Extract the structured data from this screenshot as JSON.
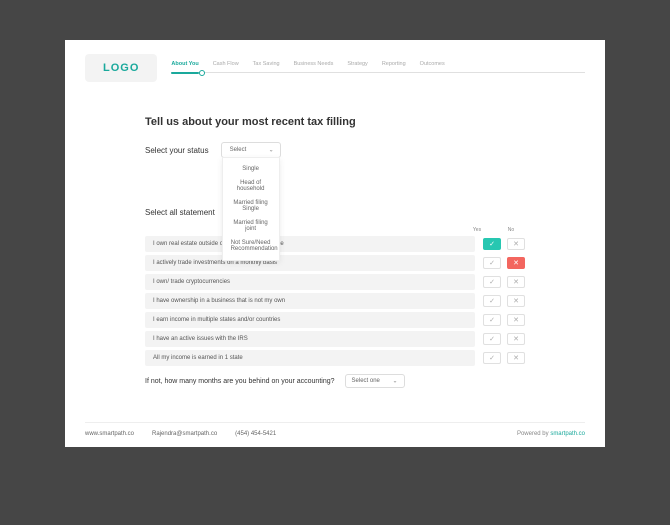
{
  "logo": "LOGO",
  "tabs": [
    {
      "label": "About You",
      "active": true
    },
    {
      "label": "Cash Flow",
      "active": false
    },
    {
      "label": "Tax Saving",
      "active": false
    },
    {
      "label": "Business Needs",
      "active": false
    },
    {
      "label": "Strategy",
      "active": false
    },
    {
      "label": "Reporting",
      "active": false
    },
    {
      "label": "Outcomes",
      "active": false
    }
  ],
  "title": "Tell us about your most recent tax filling",
  "status": {
    "label": "Select your status",
    "placeholder": "Select",
    "options": [
      "Single",
      "Head of household",
      "Married filing Single",
      "Married filing joint",
      "Not Sure/Need Recommendation"
    ]
  },
  "statements": {
    "label": "Select all statement",
    "yes": "Yes",
    "no": "No",
    "items": [
      {
        "text": "I own real estate outside of my primary residence",
        "sel": "yes"
      },
      {
        "text": "I actively trade investments on a monthly basis",
        "sel": "no"
      },
      {
        "text": "I own/ trade cryptocurrencies",
        "sel": null
      },
      {
        "text": "I have ownership in a business that is not my own",
        "sel": null
      },
      {
        "text": "I earn income in multiple states and/or countries",
        "sel": null
      },
      {
        "text": "I have an active issues with the IRS",
        "sel": null
      },
      {
        "text": "All my income is earned in 1 state",
        "sel": null
      }
    ]
  },
  "months": {
    "label": "If not, how many months are you behind on your accounting?",
    "placeholder": "Select one"
  },
  "footer": {
    "site": "www.smartpath.co",
    "email": "Rajendra@smartpath.co",
    "phone": "(454) 454-5421",
    "powered_label": "Powered by",
    "powered_link": "smartpath.co"
  }
}
